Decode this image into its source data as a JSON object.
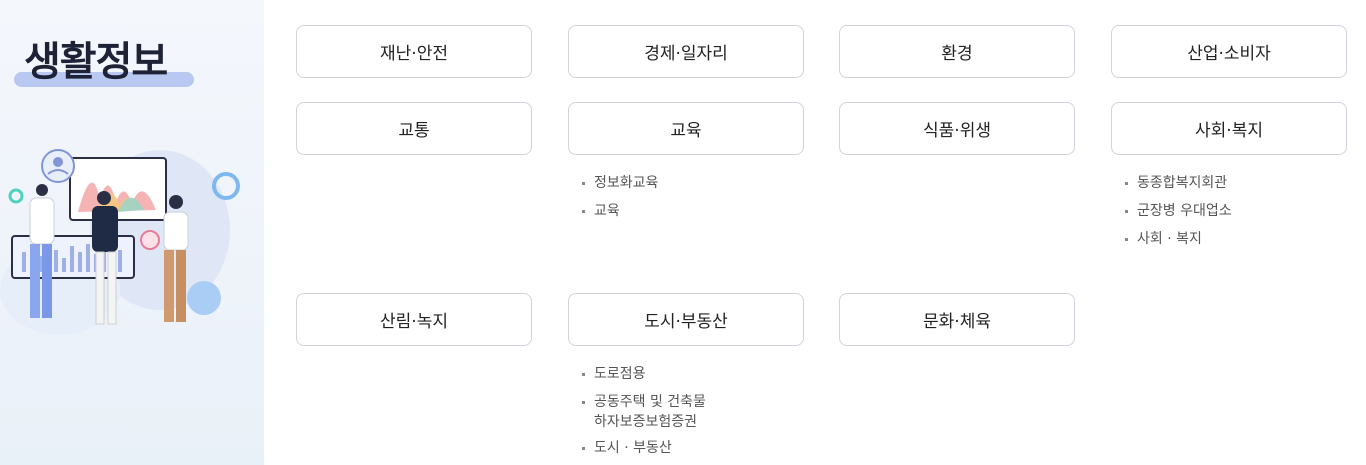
{
  "sidebar": {
    "title": "생활정보"
  },
  "categories": [
    {
      "label": "재난·안전"
    },
    {
      "label": "경제·일자리"
    },
    {
      "label": "환경"
    },
    {
      "label": "산업·소비자"
    },
    {
      "label": "교통"
    },
    {
      "label": "교육",
      "items": [
        "정보화교육",
        "교육"
      ]
    },
    {
      "label": "식품·위생"
    },
    {
      "label": "사회·복지",
      "items": [
        "동종합복지회관",
        "군장병 우대업소",
        "사회 · 복지"
      ]
    },
    {
      "label": "산림·녹지"
    },
    {
      "label": "도시·부동산",
      "items": [
        "도로점용",
        "공동주택 및 건축물\n하자보증보험증권",
        "도시 · 부동산"
      ]
    },
    {
      "label": "문화·체육"
    }
  ],
  "colors": {
    "accent_bar": "#b9c8f1",
    "title_text": "#1d2236",
    "border": "#cfd4db"
  }
}
